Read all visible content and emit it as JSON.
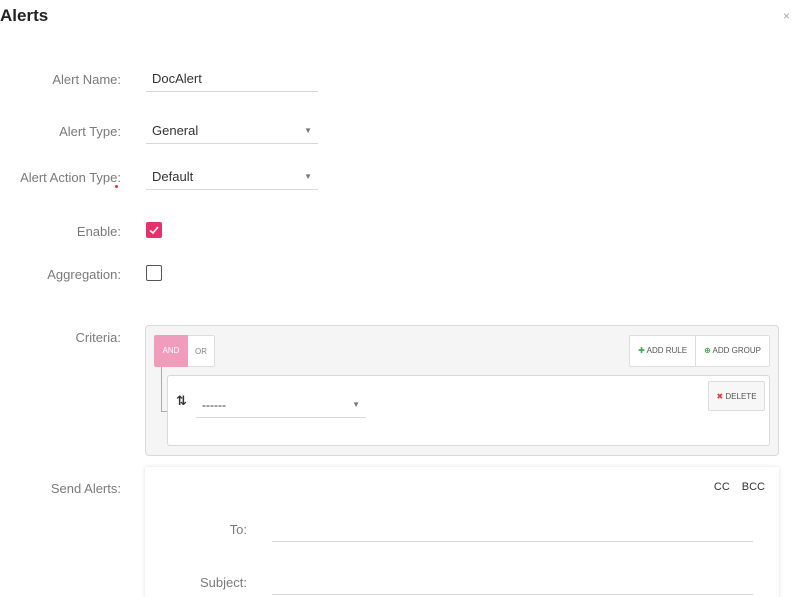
{
  "dialog": {
    "title": "Alerts",
    "close_icon": "×"
  },
  "form": {
    "alert_name": {
      "label": "Alert Name:",
      "value": "DocAlert"
    },
    "alert_type": {
      "label": "Alert Type:",
      "value": "General"
    },
    "alert_action_type": {
      "label": "Alert Action Type:",
      "value": "Default",
      "required": true
    },
    "enable": {
      "label": "Enable:",
      "checked": true
    },
    "aggregation": {
      "label": "Aggregation:",
      "checked": false
    },
    "criteria": {
      "label": "Criteria:",
      "and_label": "AND",
      "or_label": "OR",
      "add_rule_label": "ADD RULE",
      "add_group_label": "ADD GROUP",
      "rule": {
        "sort_icon": "sort-icon",
        "select_value": "------",
        "delete_label": "DELETE"
      }
    },
    "send_alerts": {
      "label": "Send Alerts:",
      "cc_label": "CC",
      "bcc_label": "BCC",
      "to_label": "To:",
      "subject_label": "Subject:"
    }
  },
  "colors": {
    "accent": "#e8306a",
    "and_active": "#f09cbb",
    "add_icons": "#3aa84a",
    "delete_icon": "#e83b3b"
  }
}
